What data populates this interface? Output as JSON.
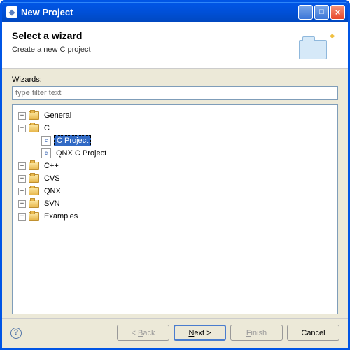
{
  "window": {
    "title": "New Project"
  },
  "header": {
    "title": "Select a wizard",
    "subtitle": "Create a new C project"
  },
  "filter": {
    "label_pre": "W",
    "label_post": "izards:",
    "placeholder": "type filter text"
  },
  "tree": {
    "general": "General",
    "c": "C",
    "cproject": "C Project",
    "qnxc": "QNX C Project",
    "cpp": "C++",
    "cvs": "CVS",
    "qnx": "QNX",
    "svn": "SVN",
    "examples": "Examples"
  },
  "buttons": {
    "back_pre": "< ",
    "back_u": "B",
    "back_post": "ack",
    "next_u": "N",
    "next_post": "ext >",
    "finish_u": "F",
    "finish_post": "inish",
    "cancel": "Cancel"
  }
}
